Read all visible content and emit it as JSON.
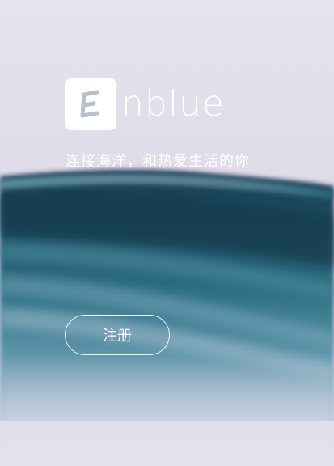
{
  "brand": {
    "logo_icon": "E-letter-logo-icon",
    "wordmark": "nblue",
    "badge_color": "#ffffff"
  },
  "hero": {
    "tagline": "连接海洋，和热爱生活的你",
    "background": "ocean-wave-image"
  },
  "actions": {
    "register_label": "注册"
  },
  "colors": {
    "text": "#ffffff",
    "sky": "#e3dfec",
    "wave_dark": "#1c4b5e",
    "wave_teal": "#3b7f92"
  }
}
